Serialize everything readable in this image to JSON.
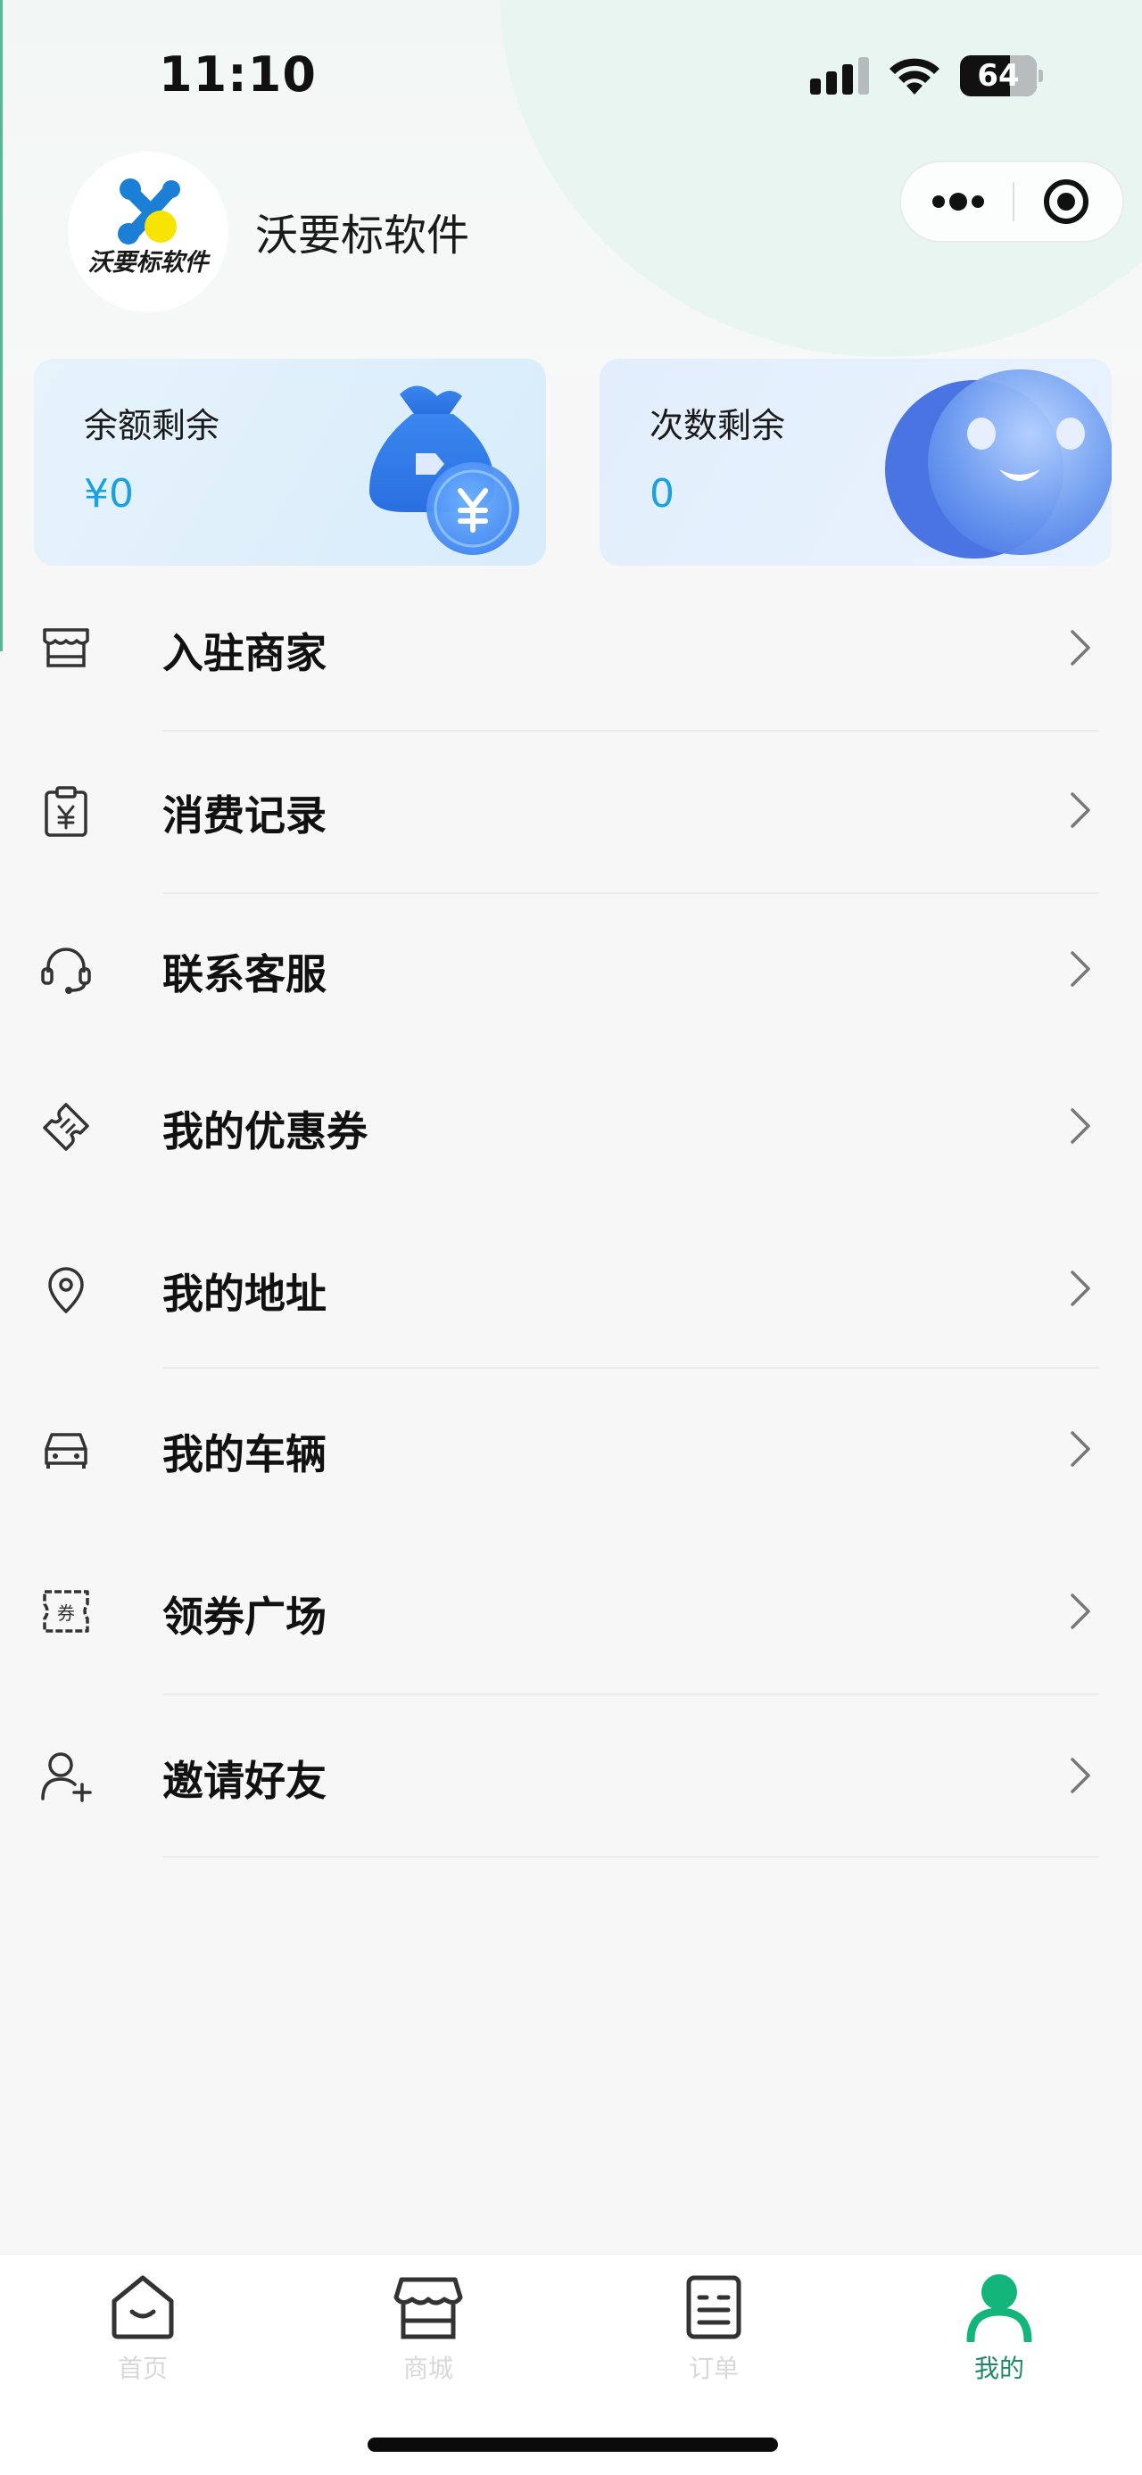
{
  "status_bar": {
    "time": "11:10",
    "battery_level": "64",
    "icons": [
      "signal-icon",
      "wifi-icon",
      "battery-icon"
    ]
  },
  "header": {
    "logo_text": "沃要标软件",
    "app_name": "沃要标软件",
    "capsule_icons": [
      "more-icon",
      "target-icon"
    ]
  },
  "cards": {
    "balance": {
      "label": "余额剩余",
      "value": "¥0",
      "icon": "money-bag-icon"
    },
    "count": {
      "label": "次数剩余",
      "value": "0",
      "icon": "smiley-bubble-icon"
    }
  },
  "menu": [
    {
      "label": "入驻商家",
      "icon": "store-icon"
    },
    {
      "label": "消费记录",
      "icon": "receipt-icon"
    },
    {
      "label": "联系客服",
      "icon": "headset-icon"
    },
    {
      "label": "我的优惠券",
      "icon": "ticket-icon"
    },
    {
      "label": "我的地址",
      "icon": "location-pin-icon"
    },
    {
      "label": "我的车辆",
      "icon": "car-icon"
    },
    {
      "label": "领券广场",
      "icon": "coupon-icon"
    },
    {
      "label": "邀请好友",
      "icon": "add-user-icon"
    }
  ],
  "coupon_icon_text": "券",
  "tabs": [
    {
      "label": "首页",
      "icon": "home-icon"
    },
    {
      "label": "商城",
      "icon": "shop-icon"
    },
    {
      "label": "订单",
      "icon": "order-icon"
    },
    {
      "label": "我的",
      "icon": "profile-icon",
      "active": true
    }
  ],
  "colors": {
    "accent": "#1f8a64",
    "value_blue": "#1ba1e0",
    "background": "#f7f7f8"
  }
}
